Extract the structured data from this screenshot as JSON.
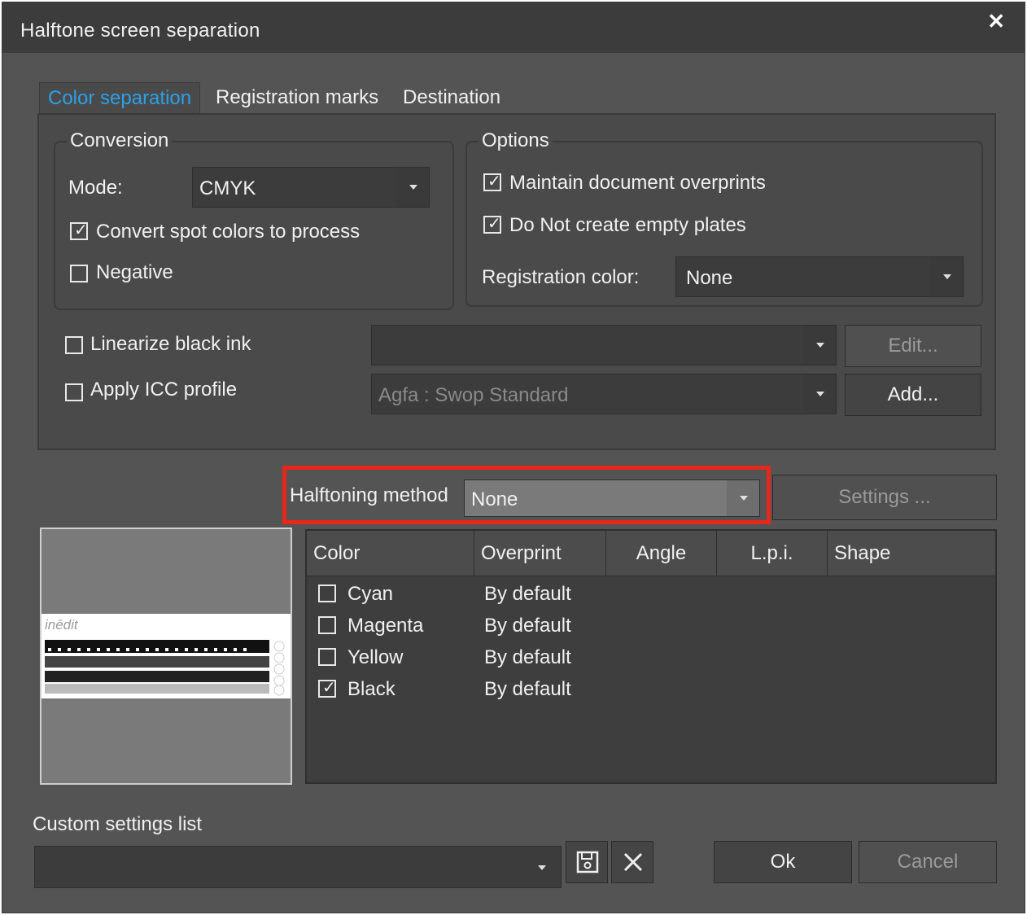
{
  "window": {
    "title": "Halftone screen separation",
    "close_glyph": "✕"
  },
  "tabs": [
    {
      "label": "Color separation",
      "active": true
    },
    {
      "label": "Registration marks",
      "active": false
    },
    {
      "label": "Destination",
      "active": false
    }
  ],
  "conversion": {
    "group_label": "Conversion",
    "mode_label": "Mode:",
    "mode_value": "CMYK",
    "convert_spot": {
      "label": "Convert spot colors to process",
      "checked": true
    },
    "negative": {
      "label": "Negative",
      "checked": false
    }
  },
  "options": {
    "group_label": "Options",
    "maintain_overprints": {
      "label": "Maintain document overprints",
      "checked": true
    },
    "no_empty_plates": {
      "label": "Do Not create empty plates",
      "checked": true
    },
    "registration_color_label": "Registration color:",
    "registration_color_value": "None"
  },
  "linearize": {
    "label": "Linearize black ink",
    "checked": false,
    "combo_value": "",
    "edit_button": "Edit..."
  },
  "icc": {
    "label": "Apply ICC profile",
    "checked": false,
    "combo_value": "Agfa : Swop Standard",
    "add_button": "Add..."
  },
  "halftoning": {
    "label": "Halftoning method",
    "value": "None",
    "settings_button": "Settings ..."
  },
  "preview": {
    "brand_text": "inēdit"
  },
  "table": {
    "headers": [
      "Color",
      "Overprint",
      "Angle",
      "L.p.i.",
      "Shape"
    ],
    "rows": [
      {
        "color": "Cyan",
        "overprint": "By default",
        "checked": false
      },
      {
        "color": "Magenta",
        "overprint": "By default",
        "checked": false
      },
      {
        "color": "Yellow",
        "overprint": "By default",
        "checked": false
      },
      {
        "color": "Black",
        "overprint": "By default",
        "checked": true
      }
    ]
  },
  "custom_settings": {
    "label": "Custom settings list",
    "value": ""
  },
  "footer": {
    "ok_label": "Ok",
    "cancel_label": "Cancel"
  },
  "colors": {
    "accent": "#2aa0e8",
    "highlight": "#e8271c",
    "background": "#545454"
  }
}
